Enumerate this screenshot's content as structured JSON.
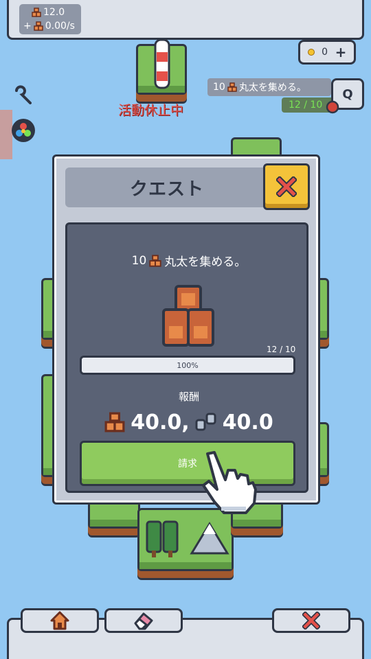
{
  "resources": {
    "logs_amount": "12.0",
    "logs_rate": "0.00/s",
    "rate_prefix": "+"
  },
  "coins": {
    "amount": "0",
    "add_label": "+"
  },
  "tracker": {
    "goal_count": "10",
    "goal_text": "丸太を集める。",
    "progress": "12 / 10",
    "q_label": "Q"
  },
  "building_status": "活動休止中",
  "quest": {
    "title": "クエスト",
    "goal_count": "10",
    "goal_text": "丸太を集める。",
    "count": "12 / 10",
    "progress_percent": 100,
    "progress_label": "100%",
    "reward_label": "報酬",
    "reward_logs": "40.0,",
    "reward_stone": "40.0",
    "claim_label": "請求"
  },
  "colors": {
    "sky": "#93c8f2",
    "panel": "#5a6275",
    "claim": "#8fcb5e",
    "close": "#f4c33a",
    "status_red": "#e4514a",
    "progress_green": "#79e255"
  },
  "icons": [
    "logs-icon",
    "coin-icon",
    "wrench-icon",
    "palette-icon",
    "close-icon",
    "stone-icon",
    "pointer-hand-icon",
    "house-icon",
    "eraser-icon"
  ]
}
